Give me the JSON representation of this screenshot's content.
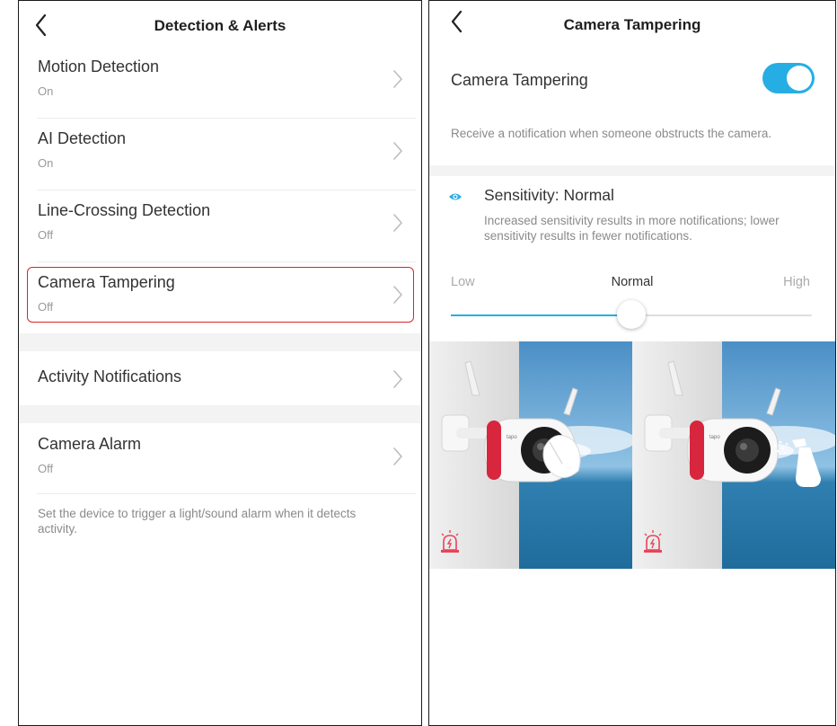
{
  "left_panel": {
    "title": "Detection & Alerts",
    "items": [
      {
        "label": "Motion Detection",
        "status": "On"
      },
      {
        "label": "AI Detection",
        "status": "On"
      },
      {
        "label": "Line-Crossing Detection",
        "status": "Off"
      },
      {
        "label": "Camera Tampering",
        "status": "Off"
      }
    ],
    "activity": {
      "label": "Activity Notifications"
    },
    "alarm": {
      "label": "Camera Alarm",
      "status": "Off",
      "footnote": "Set the device to trigger a light/sound alarm when it detects activity."
    }
  },
  "right_panel": {
    "title": "Camera Tampering",
    "toggle": {
      "label": "Camera Tampering",
      "enabled": true
    },
    "description": "Receive a notification when someone obstructs the camera.",
    "sensitivity": {
      "title": "Sensitivity: Normal",
      "description": "Increased sensitivity results in more notifications; lower sensitivity results in fewer notifications.",
      "low_label": "Low",
      "normal_label": "Normal",
      "high_label": "High",
      "level": 0.5
    },
    "illustrations": [
      {
        "brand": "tapo",
        "obstruction": "hand"
      },
      {
        "brand": "tapo",
        "obstruction": "spray"
      }
    ]
  },
  "colors": {
    "accent": "#26aee4",
    "highlight": "#d9252a",
    "alarm_icon": "#e8445a"
  },
  "icons": [
    "back-arrow-icon",
    "chevron-right-icon",
    "eye-icon",
    "alarm-light-icon"
  ]
}
